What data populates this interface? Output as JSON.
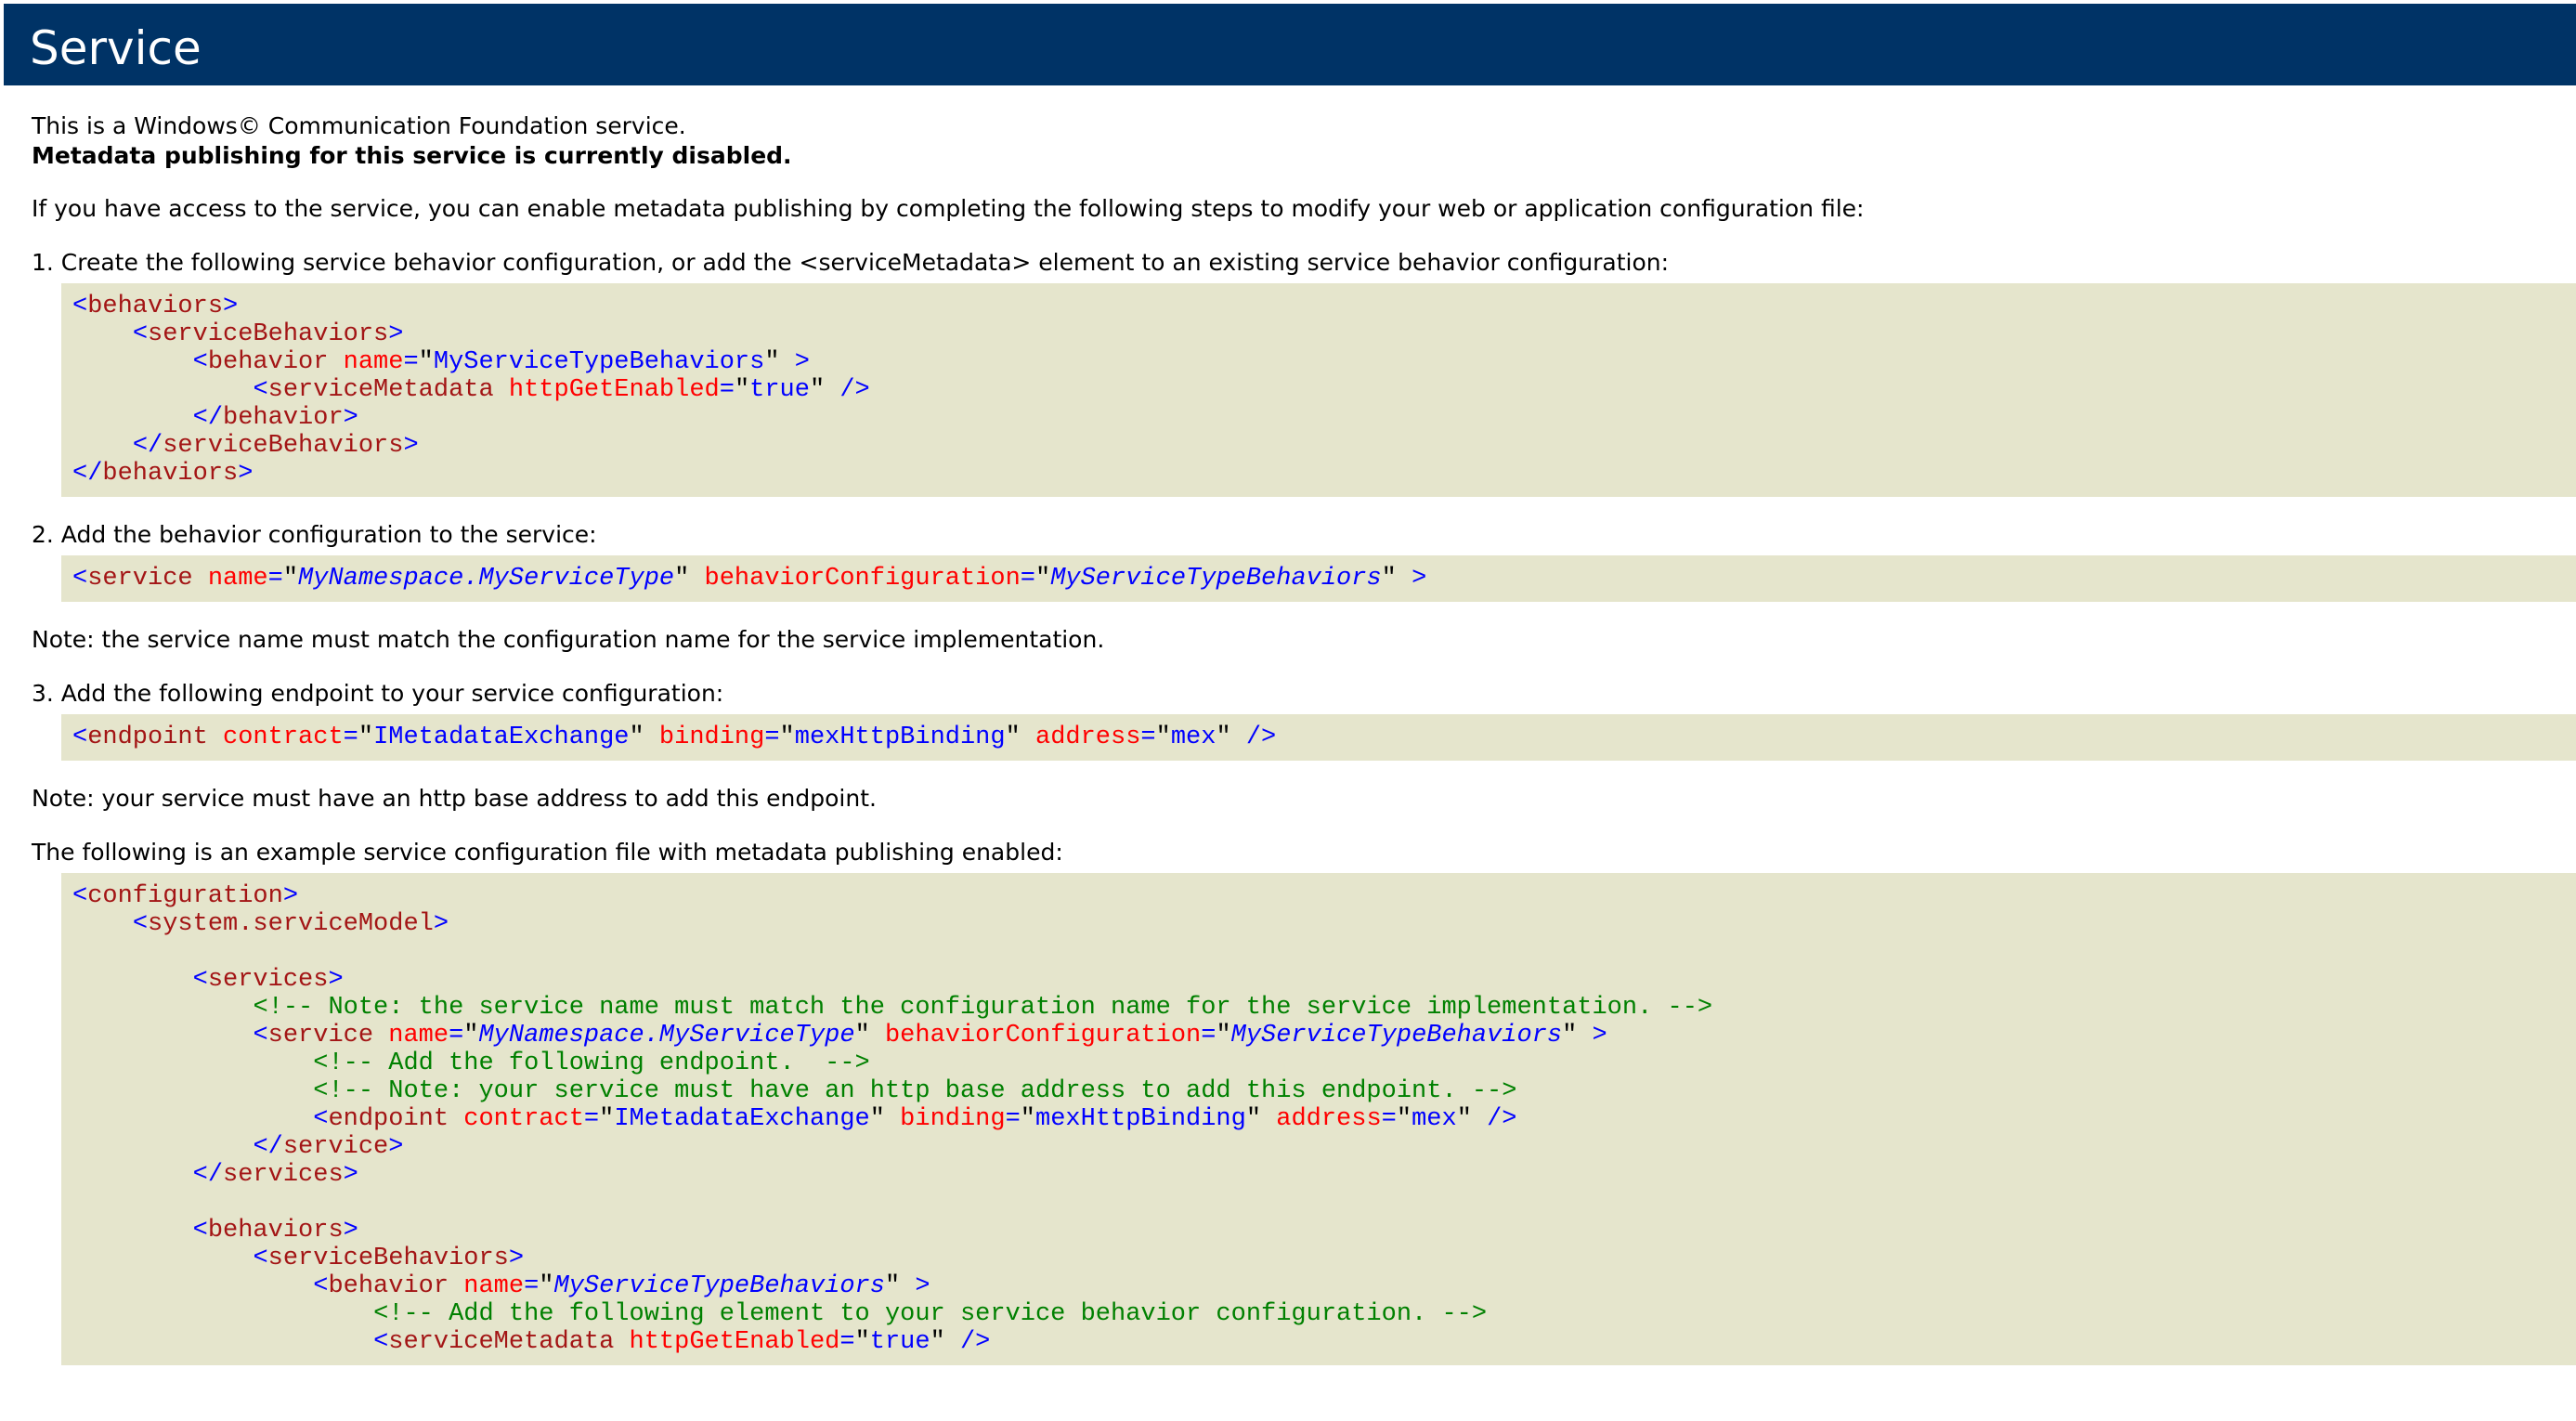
{
  "header": {
    "title": "Service"
  },
  "intro": "This is a Windows© Communication Foundation service.",
  "disabled_notice": "Metadata publishing for this service is currently disabled.",
  "instructions": "If you have access to the service, you can enable metadata publishing by completing the following steps to modify your web or application configuration file:",
  "step1": "1. Create the following service behavior configuration, or add the <serviceMetadata> element to an existing service behavior configuration:",
  "step2": "2. Add the behavior configuration to the service:",
  "note1": "Note: the service name must match the configuration name for the service implementation.",
  "step3": "3. Add the following endpoint to your service configuration:",
  "note2": "Note: your service must have an http base address to add this endpoint.",
  "example_intro": "The following is an example service configuration file with metadata publishing enabled:",
  "code": {
    "behaviors": "behaviors",
    "serviceBehaviors": "serviceBehaviors",
    "behavior": "behavior",
    "service": "service",
    "services": "services",
    "serviceMetadata": "serviceMetadata",
    "endpoint": "endpoint",
    "configuration": "configuration",
    "systemServiceModel": "system.serviceModel",
    "name_attr": "name",
    "httpGetEnabled_attr": "httpGetEnabled",
    "behaviorConfiguration_attr": "behaviorConfiguration",
    "contract_attr": "contract",
    "binding_attr": "binding",
    "address_attr": "address",
    "behavior_name_value": "MyServiceTypeBehaviors",
    "true_value": "true",
    "service_name_value": "MyNamespace.MyServiceType",
    "contract_value": "IMetadataExchange",
    "binding_value": "mexHttpBinding",
    "address_value": "mex",
    "comment_note_name": "<!-- Note: the service name must match the configuration name for the service implementation. -->",
    "comment_add_endpoint": "<!-- Add the following endpoint.  -->",
    "comment_note_base": "<!-- Note: your service must have an http base address to add this endpoint. -->",
    "comment_add_element": "<!-- Add the following element to your service behavior configuration. -->"
  }
}
